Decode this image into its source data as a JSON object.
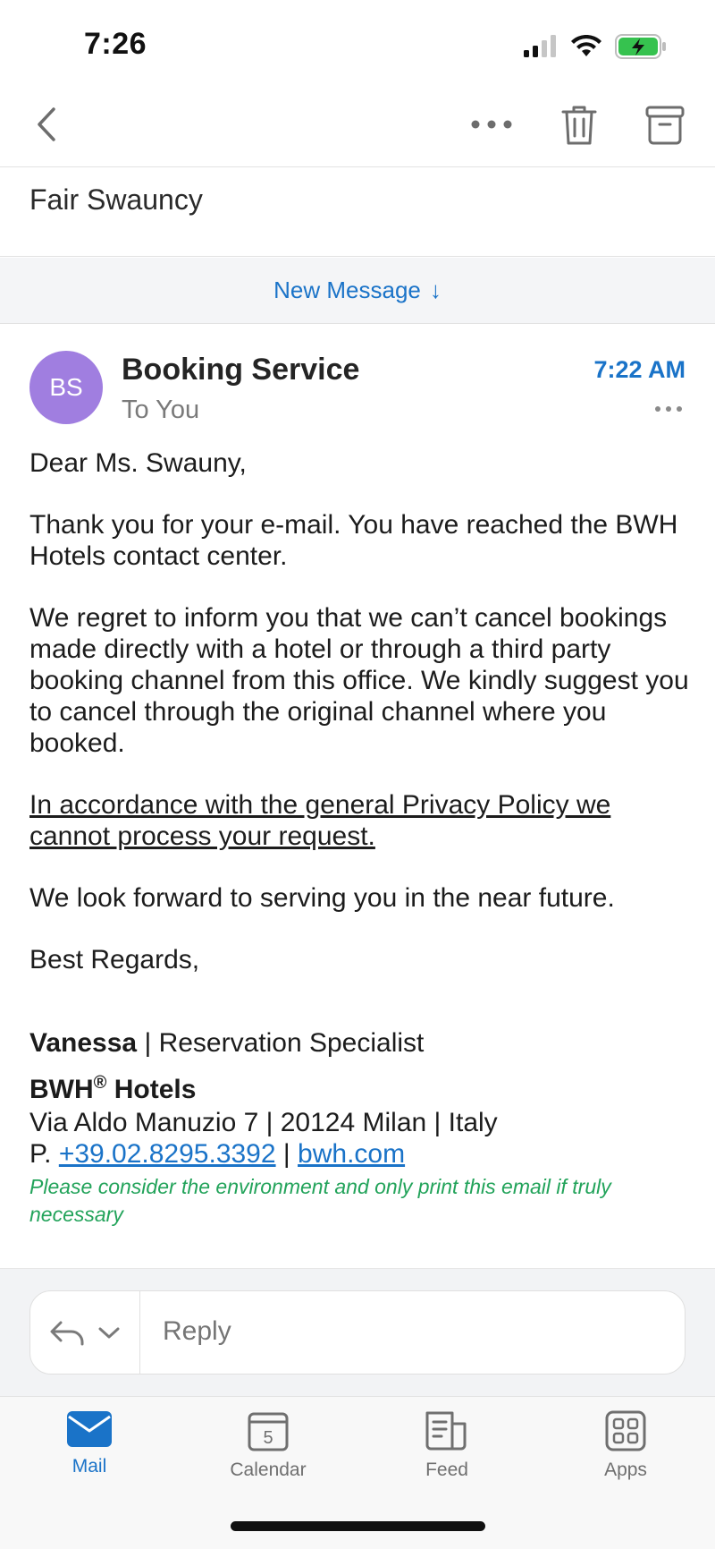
{
  "status_bar": {
    "time": "7:26",
    "icons": [
      "cellular-signal-icon",
      "wifi-icon",
      "battery-charging-icon"
    ]
  },
  "nav": {
    "icons": [
      "back-chevron-icon",
      "more-horizontal-icon",
      "trash-icon",
      "archive-icon"
    ]
  },
  "thread": {
    "subject": "Fair Swauncy",
    "new_message_label": "New Message",
    "new_message_arrow": "↓"
  },
  "message": {
    "avatar_initials": "BS",
    "avatar_color": "#a07ee0",
    "sender": "Booking Service",
    "recipient": "To You",
    "time": "7:22 AM",
    "body": {
      "greeting": "Dear Ms. Swauny,",
      "p1": "Thank you for your e-mail. You have reached the BWH Hotels contact center.",
      "p2": "We regret to inform you that we can’t cancel bookings made directly with a hotel or through a third party booking channel from this office. We kindly suggest you to cancel through the original channel where you booked.",
      "p3": "In accordance with the general Privacy Policy we cannot process your request.",
      "p4": "We look forward to serving you in the near future.",
      "closing": "Best Regards,"
    },
    "signature": {
      "name": "Vanessa",
      "title": " | Reservation Specialist",
      "company_prefix": "BWH",
      "company_registered": "®",
      "company_suffix": " Hotels",
      "address": "Via Aldo Manuzio 7 | 20124 Milan | Italy",
      "phone_prefix": "P. ",
      "phone": "+39.02.8295.3392",
      "separator": " | ",
      "website": "bwh.com",
      "eco_note": "Please consider the environment and only print this email if truly necessary"
    }
  },
  "reply": {
    "placeholder": "Reply"
  },
  "tabs": [
    {
      "label": "Mail",
      "icon": "mail-icon",
      "active": true
    },
    {
      "label": "Calendar",
      "icon": "calendar-icon",
      "day": "5",
      "active": false
    },
    {
      "label": "Feed",
      "icon": "feed-icon",
      "active": false
    },
    {
      "label": "Apps",
      "icon": "apps-grid-icon",
      "active": false
    }
  ],
  "colors": {
    "accent": "#1a73c8",
    "eco_green": "#22a35a"
  }
}
